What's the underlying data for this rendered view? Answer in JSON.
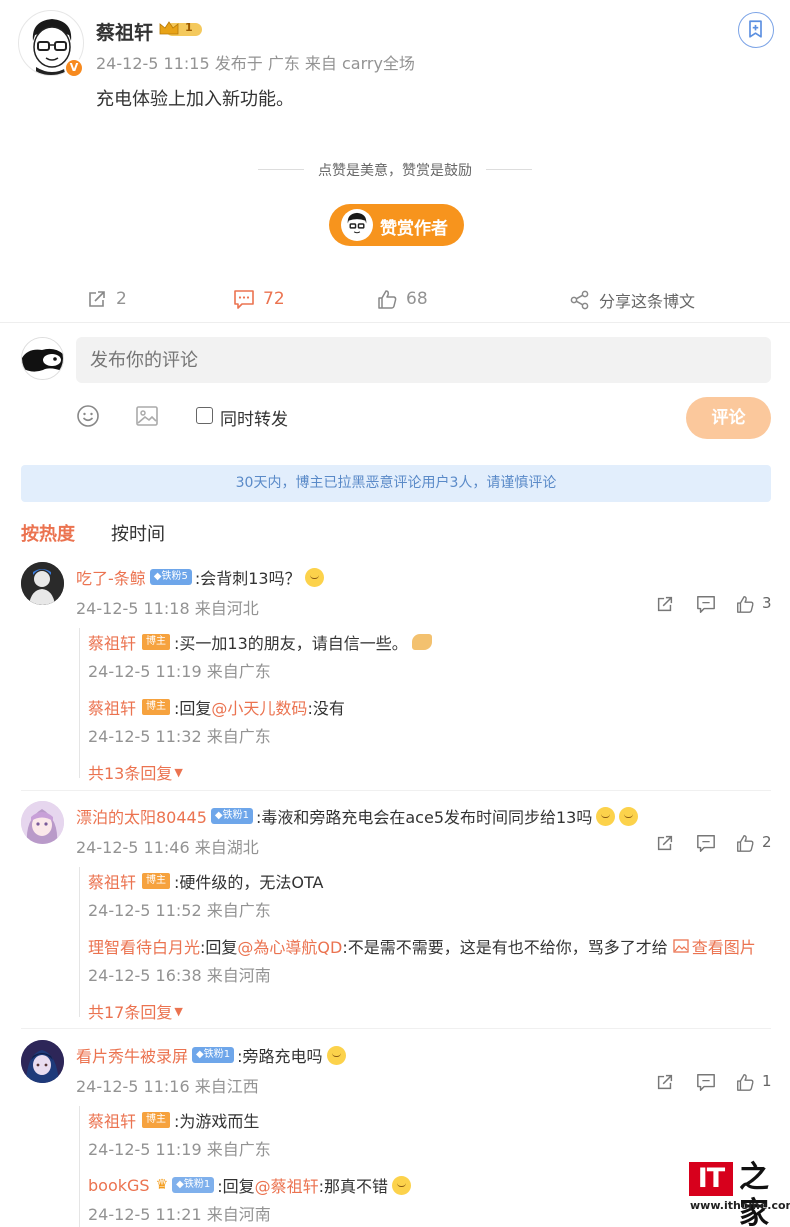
{
  "post": {
    "author": "蔡祖轩",
    "vip_level": "1",
    "verify_mark": "V",
    "meta": "24-12-5 11:15  发布于 广东  来自 carry全场",
    "text": "充电体验上加入新功能。",
    "reward_hint": "点赞是美意，赞赏是鼓励",
    "reward_button": "赞赏作者",
    "actions": {
      "repost_count": "2",
      "comment_count": "72",
      "like_count": "68",
      "share_label": "分享这条博文"
    }
  },
  "composer": {
    "placeholder": "发布你的评论",
    "repost_label": "同时转发",
    "submit_label": "评论"
  },
  "notice": "30天内，博主已拉黑恶意评论用户3人，请谨慎评论",
  "tabs": {
    "hot": "按热度",
    "time": "按时间"
  },
  "comments": [
    {
      "name": "吃了-条鲸",
      "badge": "铁粉5",
      "text": ":会背刺13吗？",
      "meta": "24-12-5 11:18 来自河北",
      "likes": "3",
      "replies": [
        {
          "name": "蔡祖轩",
          "badge": "博主",
          "text": ":买一加13的朋友，请自信一些。",
          "meta": "24-12-5 11:19 来自广东"
        },
        {
          "name": "蔡祖轩",
          "badge": "博主",
          "prefix": ":回复",
          "mention": "@小天儿数码",
          "text": ":没有",
          "meta": "24-12-5 11:32 来自广东"
        }
      ],
      "more": "共13条回复"
    },
    {
      "name": "漂泊的太阳80445",
      "badge": "铁粉1",
      "text": ":毒液和旁路充电会在ace5发布时间同步给13吗",
      "meta": "24-12-5 11:46 来自湖北",
      "likes": "2",
      "replies": [
        {
          "name": "蔡祖轩",
          "badge": "博主",
          "text": ":硬件级的，无法OTA",
          "meta": "24-12-5 11:52 来自广东"
        },
        {
          "name": "理智看待白月光",
          "prefix": ":回复",
          "mention": "@為心導航QD",
          "text": ":不是需不需要，这是有也不给你，骂多了才给",
          "image_link": "查看图片",
          "meta": "24-12-5 16:38 来自河南"
        }
      ],
      "more": "共17条回复"
    },
    {
      "name": "看片秀牛被录屏",
      "badge": "铁粉1",
      "text": ":旁路充电吗",
      "meta": "24-12-5 11:16 来自江西",
      "likes": "1",
      "replies": [
        {
          "name": "蔡祖轩",
          "badge": "博主",
          "text": ":为游戏而生",
          "meta": "24-12-5 11:19 来自广东"
        },
        {
          "name": "bookGS",
          "badge": "铁粉1",
          "prefix": ":回复",
          "mention": "@蔡祖轩",
          "text": ":那真不错",
          "meta": "24-12-5 11:21 来自河南"
        }
      ]
    }
  ],
  "watermark": {
    "logo": "IT",
    "name": "之家",
    "url": "www.ithome.com"
  },
  "colors": {
    "accent": "#eb7350",
    "reward": "#f7941d",
    "fan_badge": "#6ea6ea",
    "host_badge": "#f6a23e",
    "notice_bg": "#e2eefc"
  }
}
